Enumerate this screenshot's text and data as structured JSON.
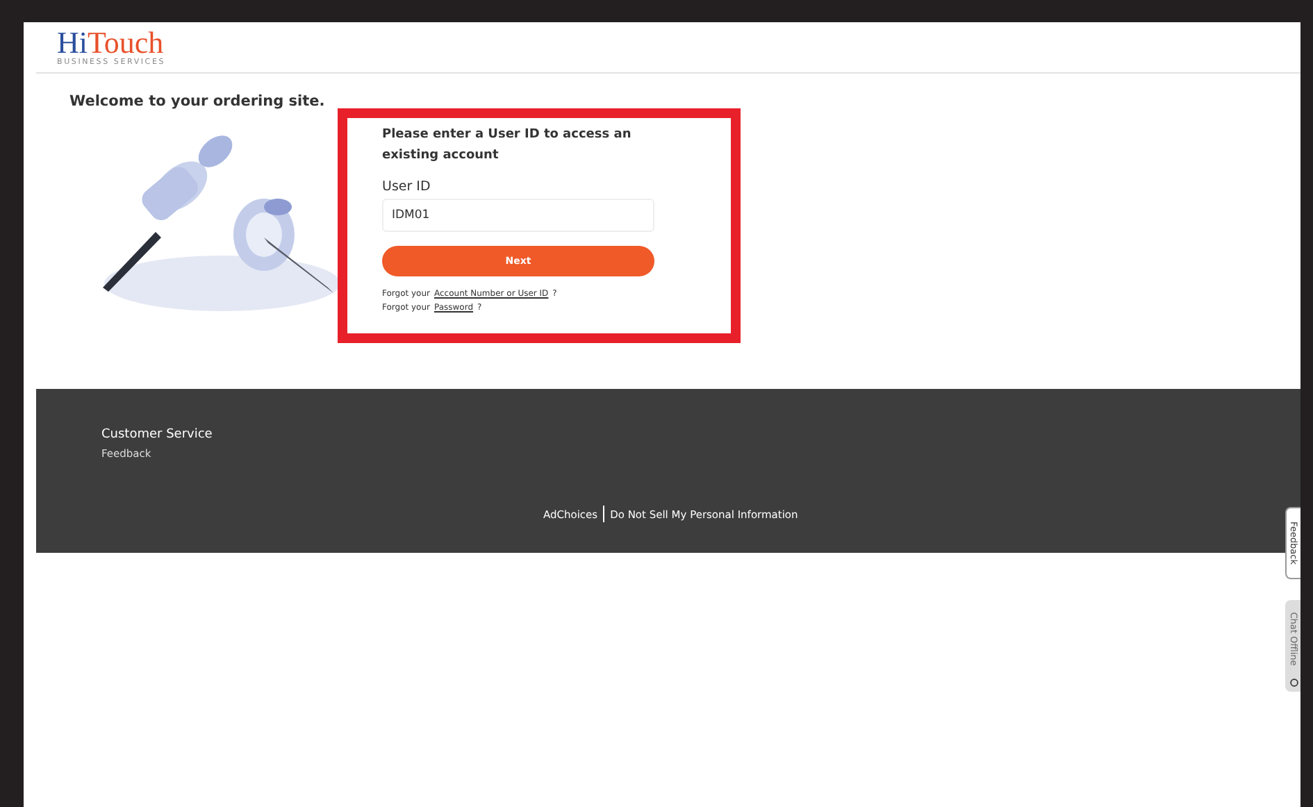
{
  "logo": {
    "brand_first": "Hi",
    "brand_second": "Touch",
    "tagline": "BUSINESS SERVICES"
  },
  "welcome": "Welcome to your ordering site.",
  "login": {
    "heading": "Please enter a User ID to access an existing account",
    "field_label": "User ID",
    "user_id": "IDM01",
    "button": "Next",
    "help": [
      {
        "prefix": "Forgot your",
        "link": "Account Number or User ID",
        "suffix": "?"
      },
      {
        "prefix": "Forgot your",
        "link": "Password",
        "suffix": "?"
      }
    ]
  },
  "footer": {
    "heading": "Customer Service",
    "links": [
      "Feedback"
    ],
    "bottom_links": [
      "AdChoices",
      "Do Not Sell My Personal Information"
    ]
  },
  "side_tabs": [
    {
      "label": "Feedback",
      "disabled": false
    },
    {
      "label": "Chat Offline",
      "disabled": true
    }
  ]
}
